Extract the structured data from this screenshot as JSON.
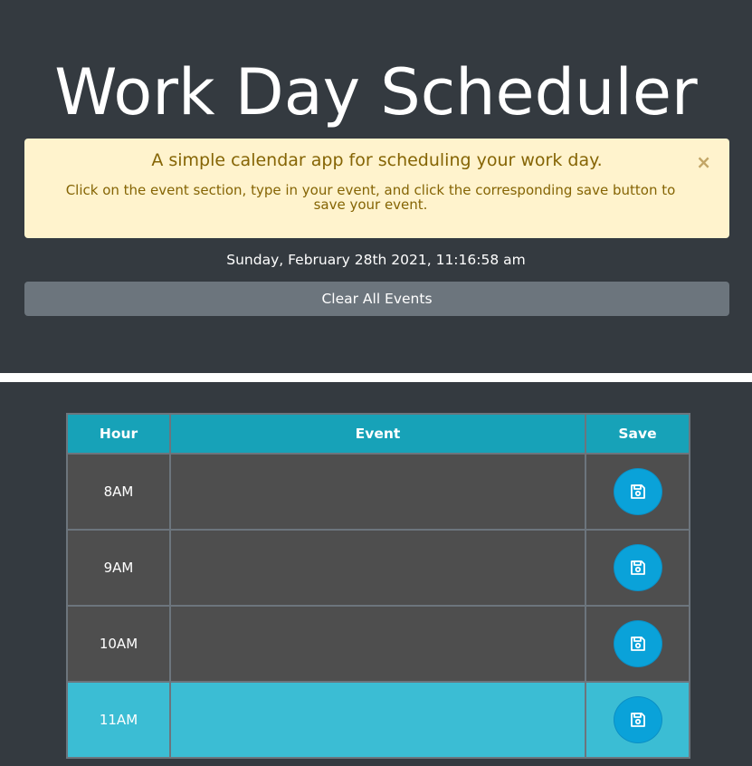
{
  "header": {
    "title": "Work Day Scheduler",
    "alert": {
      "lead": "A simple calendar app for scheduling your work day.",
      "text": "Click on the event section, type in your event, and click the corresponding save button to save your event.",
      "close": "×"
    },
    "datetime": "Sunday, February 28th 2021, 11:16:58 am",
    "clear_button": "Clear All Events"
  },
  "table": {
    "columns": [
      "Hour",
      "Event",
      "Save"
    ],
    "rows": [
      {
        "hour": "8AM",
        "event": "",
        "status": "past"
      },
      {
        "hour": "9AM",
        "event": "",
        "status": "past"
      },
      {
        "hour": "10AM",
        "event": "",
        "status": "past"
      },
      {
        "hour": "11AM",
        "event": "",
        "status": "present"
      }
    ],
    "save_icon": "floppy-disk-icon"
  },
  "colors": {
    "background": "#343a40",
    "alert_bg": "#fff3cd",
    "alert_text": "#856404",
    "header_cell": "#17a2b8",
    "past_row": "#4e4e4e",
    "present_row": "#3bbdd4",
    "save_button": "#0aa2d9",
    "clear_button": "#6c757d"
  }
}
